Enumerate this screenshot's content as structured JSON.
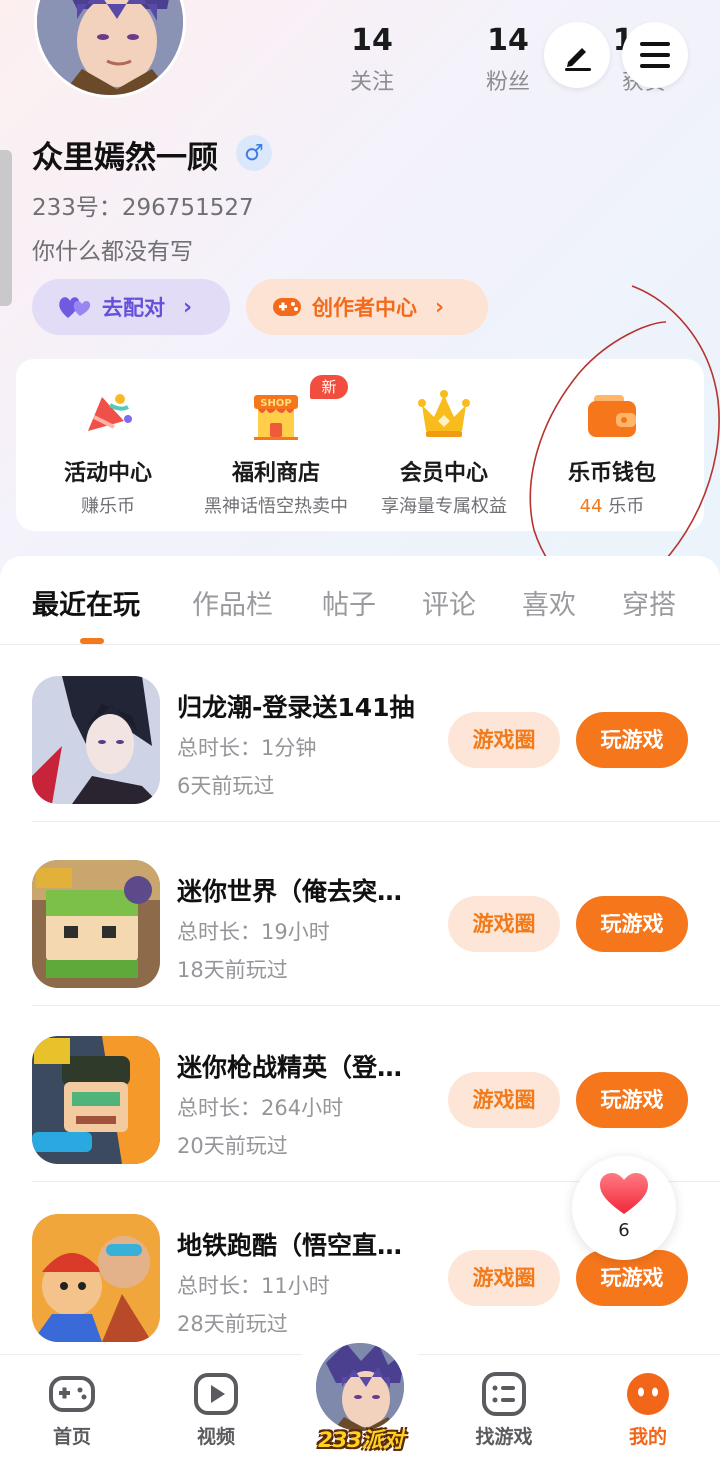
{
  "profile": {
    "name": "众里嫣然一顾",
    "gender_symbol": "♂",
    "uid": "233号：296751527",
    "bio": "你什么都没有写"
  },
  "stats": [
    {
      "value": "14",
      "label": "关注"
    },
    {
      "value": "14",
      "label": "粉丝"
    },
    {
      "value": "105",
      "label": "获赞"
    }
  ],
  "pills": {
    "match": "去配对",
    "creator": "创作者中心",
    "chevron": "›"
  },
  "quick_links": [
    {
      "title": "活动中心",
      "sub": "赚乐币"
    },
    {
      "title": "福利商店",
      "sub": "黑神话悟空热卖中",
      "badge": "新",
      "shop_text": "SHOP"
    },
    {
      "title": "会员中心",
      "sub": "享海量专属权益"
    },
    {
      "title": "乐币钱包",
      "coin_amount": "44",
      "coin_unit": " 乐币"
    }
  ],
  "tabs": [
    "最近在玩",
    "作品栏",
    "帖子",
    "评论",
    "喜欢",
    "穿搭"
  ],
  "games": [
    {
      "title": "归龙潮-登录送141抽",
      "duration": "总时长：1分钟",
      "last_played": "6天前玩过"
    },
    {
      "title": "迷你世界（俺去突…",
      "duration": "总时长：19小时",
      "last_played": "18天前玩过"
    },
    {
      "title": "迷你枪战精英（登…",
      "duration": "总时长：264小时",
      "last_played": "20天前玩过"
    },
    {
      "title": "地铁跑酷（悟空直…",
      "duration": "总时长：11小时",
      "last_played": "28天前玩过"
    }
  ],
  "game_buttons": {
    "circle": "游戏圈",
    "play": "玩游戏"
  },
  "like": {
    "count": "6"
  },
  "bottom_nav": {
    "home": "首页",
    "video": "视频",
    "center": "233派对",
    "find": "找游戏",
    "me": "我的"
  },
  "colors": {
    "accent": "#f6761c",
    "match_purple": "#6450d9",
    "coin_orange": "#f27a1a",
    "badge_red": "#f24e3f"
  }
}
